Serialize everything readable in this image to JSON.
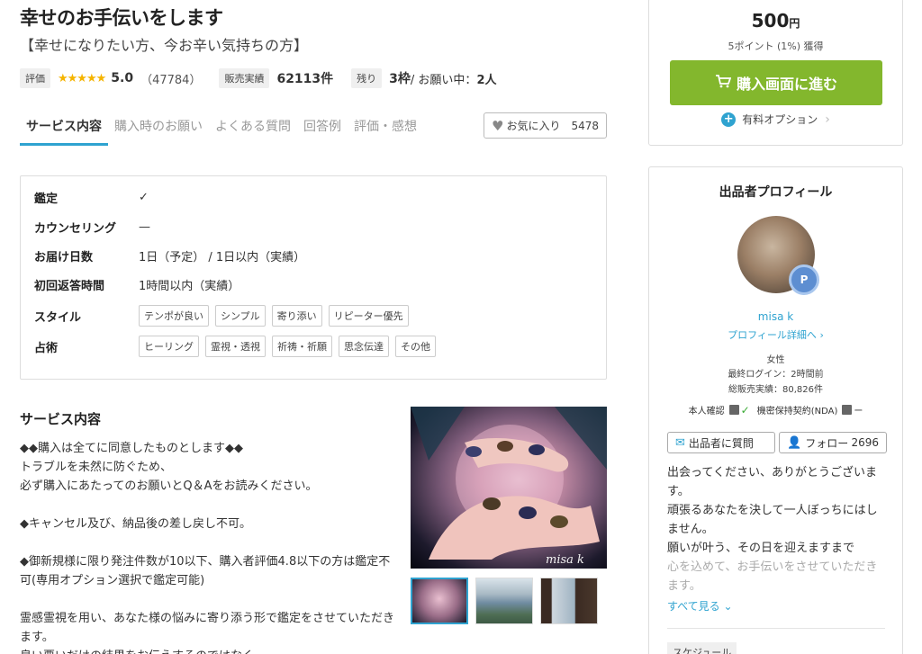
{
  "service": {
    "title": "幸せのお手伝いをします",
    "subtitle": "【幸せになりたい方、今お辛い気持ちの方】",
    "rating_label": "評価",
    "stars": "★★★★★",
    "rating": "5.0",
    "rating_count": "（47784）",
    "sales_label": "販売実績",
    "sales": "62113件",
    "remaining_label": "残り",
    "remaining": "3枠",
    "in_progress": " / お願い中：",
    "in_progress_count": "2人"
  },
  "tabs": [
    {
      "label": "サービス内容"
    },
    {
      "label": "購入時のお願い"
    },
    {
      "label": "よくある質問"
    },
    {
      "label": "回答例"
    },
    {
      "label": "評価・感想"
    }
  ],
  "favorite": {
    "label": "お気に入り",
    "count": "5478"
  },
  "details": {
    "appraisal_label": "鑑定",
    "counseling_label": "カウンセリング",
    "counseling_value": "—",
    "delivery_label": "お届け日数",
    "delivery_value": "1日（予定） / 1日以内（実績）",
    "first_reply_label": "初回返答時間",
    "first_reply_value": "1時間以内（実績）",
    "style_label": "スタイル",
    "style_tags": [
      "テンポが良い",
      "シンプル",
      "寄り添い",
      "リピーター優先"
    ],
    "divination_label": "占術",
    "divination_tags": [
      "ヒーリング",
      "霊視・透視",
      "祈祷・祈願",
      "思念伝達",
      "その他"
    ]
  },
  "content": {
    "heading": "サービス内容",
    "lines": [
      "◆◆購入は全てに同意したものとします◆◆",
      "トラブルを未然に防ぐため、",
      "必ず購入にあたってのお願いとQ＆Aをお読みください。",
      "",
      "◆キャンセル及び、納品後の差し戻し不可。",
      "",
      "◆御新規様に限り発注件数が10以下、購入者評価4.8以下の方は鑑定不可(専用オプション選択で鑑定可能)",
      "",
      "霊感霊視を用い、あなた様の悩みに寄り添う形で鑑定をさせていただきます。",
      "良い悪いだけの結果をお伝えするのではなく"
    ],
    "image_signature": "misa k"
  },
  "purchase": {
    "price": "500",
    "currency": "円",
    "points": "5ポイント (1%) 獲得",
    "buy_label": "購入画面に進む",
    "paid_option": "有料オプション"
  },
  "profile": {
    "heading": "出品者プロフィール",
    "name": "misa k",
    "detail_link": "プロフィール詳細へ",
    "gender": "女性",
    "last_login": "最終ログイン：2時間前",
    "total_sales": "総販売実績：80,826件",
    "identity_label": "本人確認",
    "nda_label": "機密保持契約(NDA)",
    "nda_value": "ー",
    "ask_label": "出品者に質問",
    "follow_label": "フォロー",
    "follow_count": "2696",
    "bio_lines": [
      "出会ってください、ありがとうございます。",
      "頑張るあなたを決して一人ぼっちにはしません。",
      "願いが叶う、その日を迎えますまで",
      "心を込めて、お手伝いをさせていただきます。"
    ],
    "see_all": "すべて見る",
    "schedule_label": "スケジュール"
  }
}
